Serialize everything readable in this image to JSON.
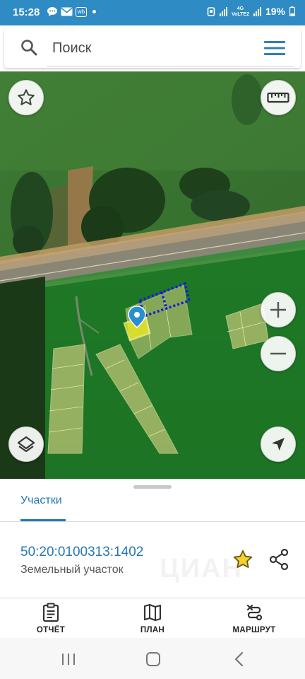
{
  "status_bar": {
    "time": "15:28",
    "notif_icons": [
      "chat-icon",
      "mail-icon",
      "wb-icon"
    ],
    "wb_label": "wb",
    "network_label_1": "VoLTE2",
    "network_label_2": "4G",
    "battery": "19%"
  },
  "search": {
    "placeholder": "Поиск"
  },
  "map": {
    "controls": [
      "favorites-star",
      "ruler",
      "zoom-in",
      "zoom-out",
      "layers",
      "my-location"
    ],
    "colors": {
      "overlay_green": "#1e8a2a",
      "parcel_yellow": "#f5ef1c",
      "measure_blue": "#1a1adb",
      "pin_blue": "#2a8fd0"
    }
  },
  "panel": {
    "tab_label": "Участки",
    "parcel_id": "50:20:0100313:1402",
    "parcel_type": "Земельный участок",
    "watermark": "ЦИАН"
  },
  "bottom_nav": {
    "report": "ОТЧЁТ",
    "plan": "ПЛАН",
    "route": "МАРШРУТ"
  }
}
